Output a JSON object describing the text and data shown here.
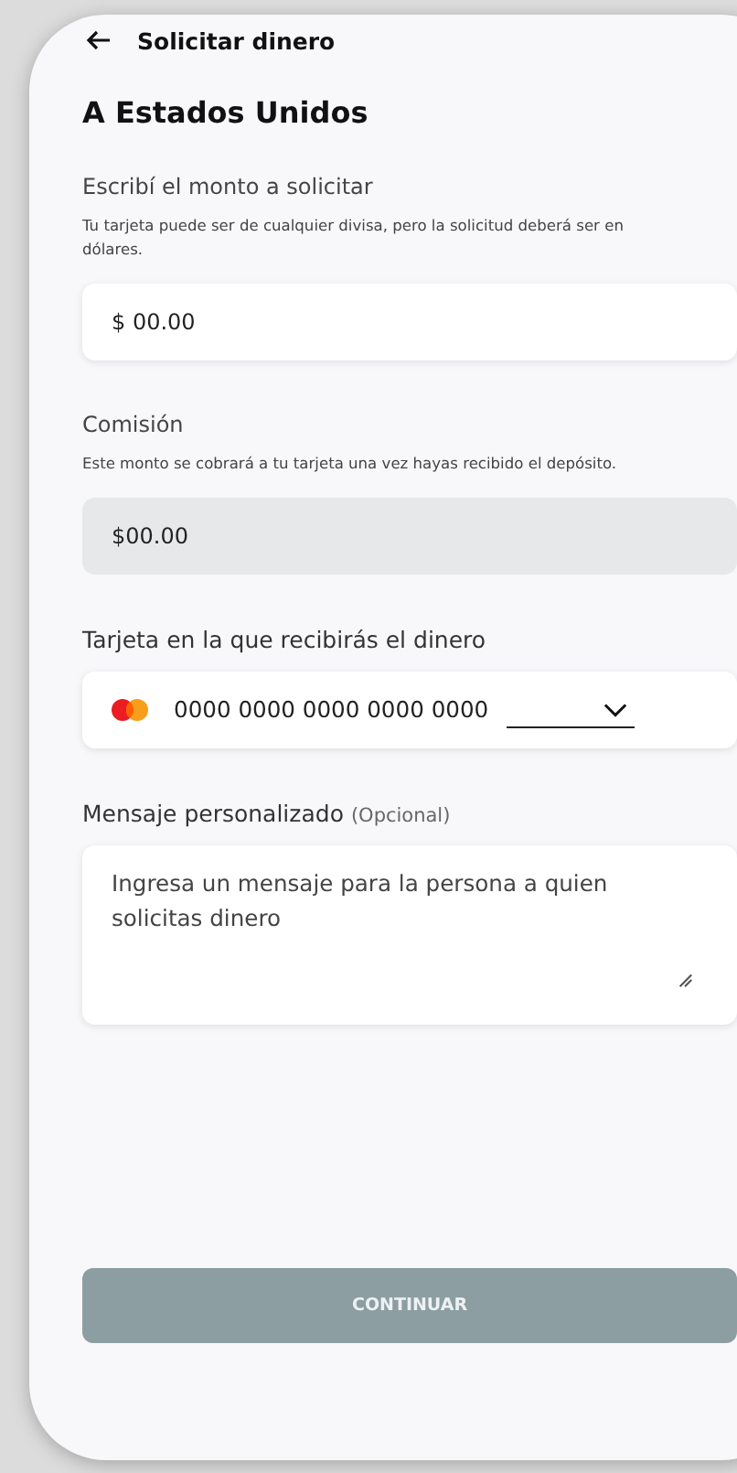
{
  "header": {
    "title": "Solicitar dinero"
  },
  "heading": "A Estados Unidos",
  "amount": {
    "label": "Escribí el monto a solicitar",
    "help": "Tu tarjeta puede ser de cualquier divisa, pero la solicitud deberá ser en dólares.",
    "value": "$ 00.00"
  },
  "commission": {
    "label": "Comisión",
    "help": "Este monto se cobrará a tu tarjeta una vez hayas recibido el depósito.",
    "value": "$00.00",
    "disabled": true
  },
  "card": {
    "label": "Tarjeta en la que recibirás el dinero",
    "value": "0000 0000 0000 0000 0000"
  },
  "message": {
    "label": "Mensaje personalizado",
    "note": "(Opcional)",
    "placeholder": "Ingresa un mensaje para la persona a quien solicitas dinero"
  },
  "button": {
    "label": "CONTINUAR",
    "disabled": true
  }
}
